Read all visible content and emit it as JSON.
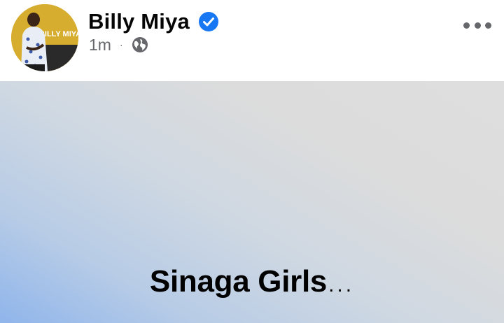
{
  "post": {
    "author": "Billy Miya",
    "verified": true,
    "timestamp": "1m",
    "separator": "·",
    "audience_icon": "globe-icon",
    "avatar_text": "BILLY MIYA",
    "more_icon": "more-options-icon",
    "banner_text": "Sinaga Girls",
    "banner_ellipsis": "...",
    "colors": {
      "verified_blue": "#1877f2",
      "name_text": "#050505",
      "meta_text": "#65676b",
      "avatar_bg": "#d6ad2e"
    }
  }
}
